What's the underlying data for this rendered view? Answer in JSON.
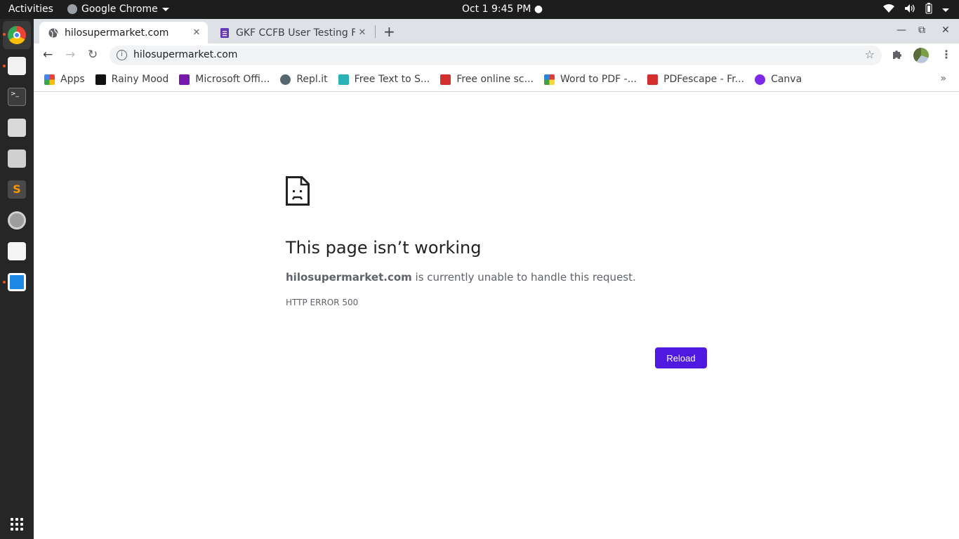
{
  "system": {
    "activities": "Activities",
    "app_name": "Google Chrome",
    "clock": "Oct 1  9:45 PM"
  },
  "tabs": [
    {
      "title": "hilosupermarket.com",
      "active": true
    },
    {
      "title": "GKF CCFB User Testing Fe",
      "active": false
    }
  ],
  "omnibox": {
    "url": "hilosupermarket.com"
  },
  "bookmarks": [
    {
      "label": "Apps",
      "color": "#4285f4"
    },
    {
      "label": "Rainy Mood",
      "color": "#111111"
    },
    {
      "label": "Microsoft Offi...",
      "color": "#7719aa"
    },
    {
      "label": "Repl.it",
      "color": "#56676e"
    },
    {
      "label": "Free Text to S...",
      "color": "#2bb0b5"
    },
    {
      "label": "Free online sc...",
      "color": "#d32f2f"
    },
    {
      "label": "Word to PDF -...",
      "color": "#f9a825"
    },
    {
      "label": "PDFescape - Fr...",
      "color": "#d32f2f"
    },
    {
      "label": "Canva",
      "color": "#7d2ae8"
    }
  ],
  "error": {
    "title": "This page isn’t working",
    "host": "hilosupermarket.com",
    "message": " is currently unable to handle this request.",
    "code": "HTTP ERROR 500",
    "reload_label": "Reload"
  },
  "colors": {
    "reload_button": "#4f19e0",
    "topbar": "#1d1d1d",
    "dock": "#262626"
  }
}
